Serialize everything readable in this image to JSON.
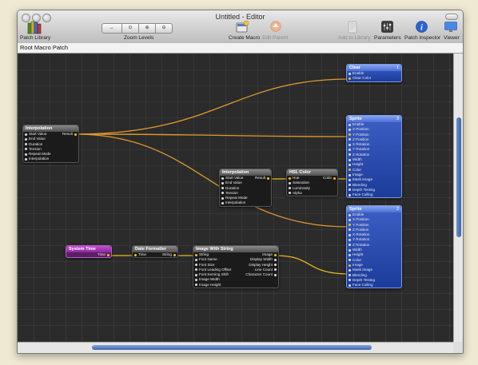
{
  "window": {
    "title": "Untitled - Editor"
  },
  "toolbar": {
    "patch_library": "Patch Library",
    "zoom_levels": "Zoom Levels",
    "create_macro": "Create Macro",
    "edit_parent": "Edit Parent",
    "add_to_library": "Add to Library",
    "parameters": "Parameters",
    "patch_inspector": "Patch Inspector",
    "viewer": "Viewer"
  },
  "pathbar": {
    "label": "Root Macro Patch"
  },
  "patches": {
    "interp1": {
      "title": "Interpolation",
      "inputs": [
        "Start Value",
        "End Value",
        "Duration",
        "Tension",
        "Repeat Mode",
        "Interpolation"
      ],
      "outputs": [
        "Result"
      ]
    },
    "interp2": {
      "title": "Interpolation",
      "inputs": [
        "Start Value",
        "End Value",
        "Duration",
        "Tension",
        "Repeat Mode",
        "Interpolation"
      ],
      "outputs": [
        "Result"
      ]
    },
    "hsl": {
      "title": "HSL Color",
      "inputs": [
        "Hue",
        "Saturation",
        "Luminosity",
        "Alpha"
      ],
      "outputs": [
        "Color"
      ]
    },
    "clear": {
      "title": "Clear",
      "number": "1",
      "inputs": [
        "Enable",
        "Clear Color"
      ]
    },
    "sprite3": {
      "title": "Sprite",
      "number": "3",
      "inputs": [
        "Enable",
        "X Position",
        "Y Position",
        "Z Position",
        "X Rotation",
        "Y Rotation",
        "Z Rotation",
        "Width",
        "Height",
        "Color",
        "Image",
        "Mask Image",
        "Blending",
        "Depth Testing",
        "Face Culling"
      ]
    },
    "sprite2": {
      "title": "Sprite",
      "number": "2",
      "inputs": [
        "Enable",
        "X Position",
        "Y Position",
        "Z Position",
        "X Rotation",
        "Y Rotation",
        "Z Rotation",
        "Width",
        "Height",
        "Color",
        "Image",
        "Mask Image",
        "Blending",
        "Depth Testing",
        "Face Culling"
      ]
    },
    "systime": {
      "title": "System Time",
      "outputs": [
        "Time"
      ]
    },
    "datefmt": {
      "title": "Date Formatter",
      "inputs": [
        "Time"
      ],
      "outputs": [
        "String"
      ]
    },
    "imgstr": {
      "title": "Image With String",
      "inputs": [
        "String",
        "Font Name",
        "Font Size",
        "Font Leading Offset",
        "Font Kerning Shift",
        "Image Width",
        "Image Height"
      ],
      "outputs": [
        "Image",
        "Display Width",
        "Display Height",
        "Line Count",
        "Character Count"
      ]
    }
  }
}
